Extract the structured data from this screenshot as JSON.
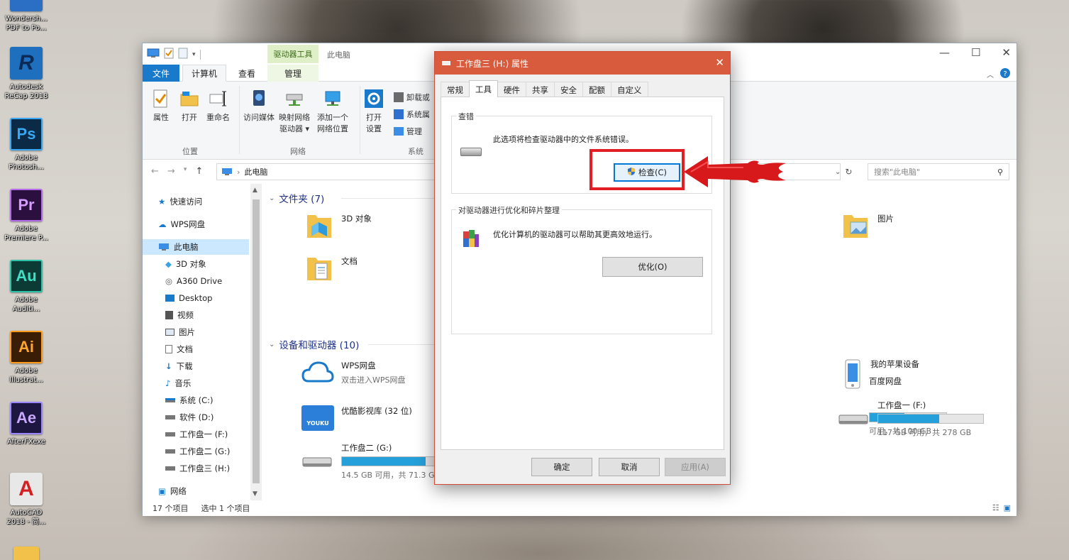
{
  "desktop": {
    "icons": [
      {
        "label": "Wondersh...\nPDF to Po...",
        "glyph": "",
        "color": "#2b6fc4"
      },
      {
        "label": "Autodesk\nReCap 2018",
        "glyph": "R",
        "color": "#1f6fbf"
      },
      {
        "label": "Adobe\nPhotosh...",
        "glyph": "Ps",
        "color": "#0b2a45"
      },
      {
        "label": "Adobe\nPremiere P...",
        "glyph": "Pr",
        "color": "#2a0f3f"
      },
      {
        "label": "Adobe\nAuditi...",
        "glyph": "Au",
        "color": "#0c3b35"
      },
      {
        "label": "Adobe\nIllustrat...",
        "glyph": "Ai",
        "color": "#3a1d05"
      },
      {
        "label": "AfterFXexe",
        "glyph": "Ae",
        "color": "#1d1640"
      },
      {
        "label": "AutoCAD\n2018 - 简...",
        "glyph": "A",
        "color": "#e8e8e8"
      }
    ]
  },
  "explorer": {
    "title": "此电脑",
    "context_tab_header": "驱动器工具",
    "tabs": {
      "file": "文件",
      "computer": "计算机",
      "view": "查看",
      "manage": "管理"
    },
    "ribbon": {
      "properties": "属性",
      "open": "打开",
      "rename": "重命名",
      "access_media": "访问媒体",
      "map_drive": "映射网络\n驱动器 ▾",
      "add_location": "添加一个\n网络位置",
      "open_settings": "打开\n设置",
      "uninstall": "卸载或",
      "system_props": "系统属",
      "manage": "管理",
      "groups": {
        "location": "位置",
        "network": "网络",
        "system": "系统"
      }
    },
    "address": {
      "path": "此电脑",
      "search_placeholder": "搜索\"此电脑\""
    },
    "nav": {
      "quick_access": "快速访问",
      "wps_cloud": "WPS网盘",
      "this_pc": "此电脑",
      "objects3d": "3D 对象",
      "a360": "A360 Drive",
      "desktop": "Desktop",
      "videos": "视频",
      "pictures": "图片",
      "documents": "文档",
      "downloads": "下载",
      "music": "音乐",
      "drive_c": "系统 (C:)",
      "drive_d": "软件 (D:)",
      "drive_f": "工作盘一 (F:)",
      "drive_g": "工作盘二 (G:)",
      "drive_h": "工作盘三 (H:)",
      "network": "网络"
    },
    "folders_header": "文件夹 (7)",
    "folders": {
      "objects3d": "3D 对象",
      "documents": "文档",
      "pictures": "图片"
    },
    "devices_header": "设备和驱动器 (10)",
    "devices": {
      "wps_name": "WPS网盘",
      "wps_sub": "双击进入WPS网盘",
      "youku_name": "优酷影视库 (32 位)",
      "youku_badge": "YOUKU",
      "baidu_name": "百度网盘",
      "apple_name": "我的苹果设备",
      "drive_g_name": "工作盘二 (G:)",
      "drive_g_free": "14.5 GB 可用，共 71.3 G",
      "drive_g_used": 0.8,
      "mid_drive_free": "可用，共 100 GB",
      "mid_drive_used": 0.45,
      "drive_f_name": "工作盘一 (F:)",
      "drive_f_free": "117 GB 可用，共 278 GB",
      "drive_f_used": 0.58
    },
    "status": {
      "items": "17 个项目",
      "selected": "选中 1 个项目"
    }
  },
  "dialog": {
    "title": "工作盘三 (H:) 属性",
    "tabs": [
      "常规",
      "工具",
      "硬件",
      "共享",
      "安全",
      "配额",
      "自定义"
    ],
    "error_check": {
      "legend": "查错",
      "text": "此选项将检查驱动器中的文件系统错误。",
      "button": "检查(C)"
    },
    "optimize": {
      "legend": "对驱动器进行优化和碎片整理",
      "text": "优化计算机的驱动器可以帮助其更高效地运行。",
      "button": "优化(O)"
    },
    "buttons": {
      "ok": "确定",
      "cancel": "取消",
      "apply": "应用(A)"
    }
  },
  "annotation": {
    "highlight_color": "#e31e24",
    "arrow_color": "#d7191c"
  }
}
